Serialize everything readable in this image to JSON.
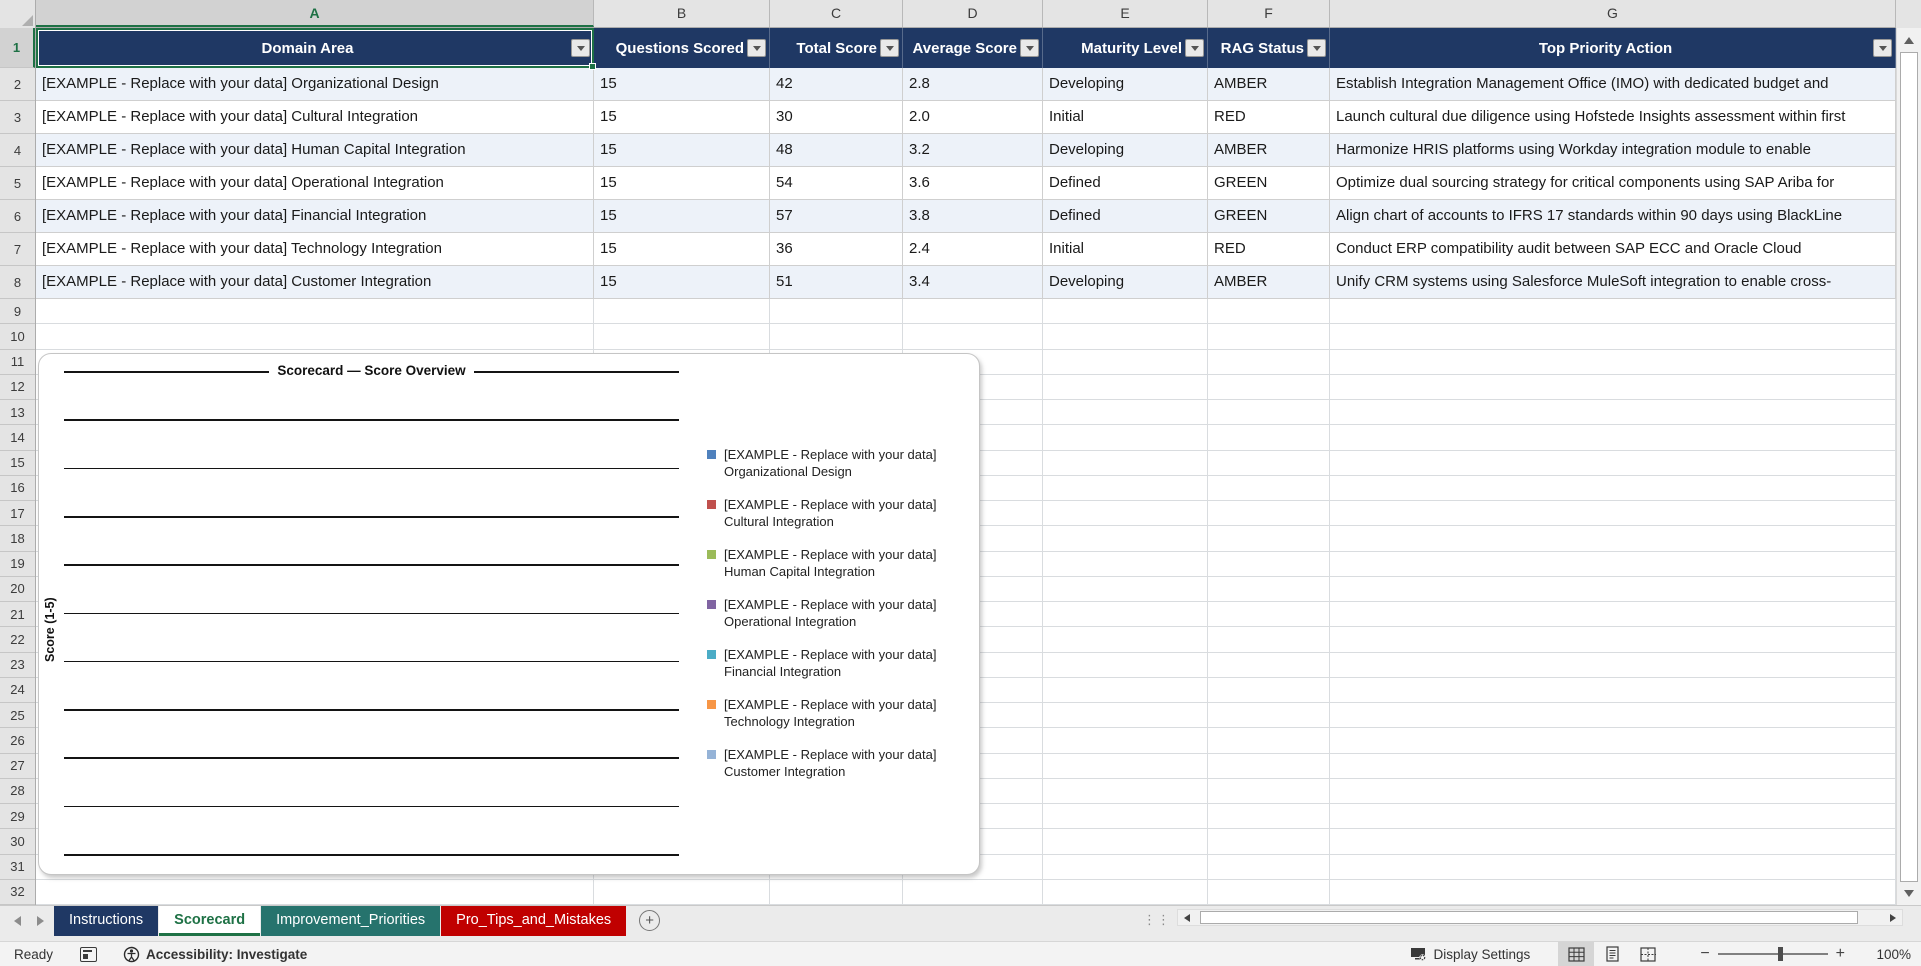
{
  "sheet": {
    "column_letters": [
      "A",
      "B",
      "C",
      "D",
      "E",
      "F",
      "G"
    ],
    "row_numbers": [
      1,
      2,
      3,
      4,
      5,
      6,
      7,
      8,
      9,
      10,
      11,
      12,
      13,
      14,
      15,
      16,
      17,
      18,
      19,
      20,
      21,
      22,
      23,
      24,
      25,
      26,
      27,
      28,
      29,
      30,
      31,
      32
    ],
    "columns": [
      "Domain Area",
      "Questions Scored",
      "Total Score",
      "Average Score",
      "Maturity Level",
      "RAG Status",
      "Top Priority Action"
    ],
    "rows": [
      [
        "[EXAMPLE - Replace with your data] Organizational Design",
        "15",
        "42",
        "2.8",
        "Developing",
        "AMBER",
        "Establish Integration Management Office (IMO) with dedicated budget and"
      ],
      [
        "[EXAMPLE - Replace with your data] Cultural Integration",
        "15",
        "30",
        "2.0",
        "Initial",
        "RED",
        "Launch cultural due diligence using Hofstede Insights assessment within first"
      ],
      [
        "[EXAMPLE - Replace with your data] Human Capital Integration",
        "15",
        "48",
        "3.2",
        "Developing",
        "AMBER",
        "Harmonize HRIS platforms using Workday integration module to enable"
      ],
      [
        "[EXAMPLE - Replace with your data] Operational Integration",
        "15",
        "54",
        "3.6",
        "Defined",
        "GREEN",
        "Optimize dual sourcing strategy for critical components using SAP Ariba for"
      ],
      [
        "[EXAMPLE - Replace with your data] Financial Integration",
        "15",
        "57",
        "3.8",
        "Defined",
        "GREEN",
        "Align chart of accounts to IFRS 17 standards within 90 days using BlackLine"
      ],
      [
        "[EXAMPLE - Replace with your data] Technology Integration",
        "15",
        "36",
        "2.4",
        "Initial",
        "RED",
        "Conduct ERP compatibility audit between SAP ECC and Oracle Cloud"
      ],
      [
        "[EXAMPLE - Replace with your data] Customer Integration",
        "15",
        "51",
        "3.4",
        "Developing",
        "AMBER",
        "Unify CRM systems using Salesforce MuleSoft integration to enable cross-"
      ]
    ],
    "header_bg": "#1F3864",
    "banded_row_bg": "#EDF2F9"
  },
  "chart": {
    "type": "bar",
    "title": "Scorecard — Score Overview",
    "ylabel": "Score (1-5)",
    "legend_prefix": "[EXAMPLE - Replace with your data]",
    "legend": [
      {
        "name": "Organizational Design",
        "color": "#4F81BD"
      },
      {
        "name": "Cultural Integration",
        "color": "#C0504D"
      },
      {
        "name": "Human Capital Integration",
        "color": "#9BBB59"
      },
      {
        "name": "Operational Integration",
        "color": "#8064A2"
      },
      {
        "name": "Financial Integration",
        "color": "#4BACC6"
      },
      {
        "name": "Technology Integration",
        "color": "#F79646"
      },
      {
        "name": "Customer Integration",
        "color": "#95B3D7"
      }
    ],
    "values_visible": false,
    "gridlines": "horizontal"
  },
  "tabs": {
    "items": [
      {
        "label": "Instructions",
        "bg": "#1F3864",
        "text": "#FFFFFF",
        "active": false
      },
      {
        "label": "Scorecard",
        "bg": "#FFFFFF",
        "text": "#1E7145",
        "active": true
      },
      {
        "label": "Improvement_Priorities",
        "bg": "#26736D",
        "text": "#FFFFFF",
        "active": false
      },
      {
        "label": "Pro_Tips_and_Mistakes",
        "bg": "#C00000",
        "text": "#FFFFFF",
        "active": false
      }
    ]
  },
  "status_bar": {
    "ready": "Ready",
    "accessibility": "Accessibility: Investigate",
    "display_settings": "Display Settings",
    "zoom_level": "100%"
  }
}
